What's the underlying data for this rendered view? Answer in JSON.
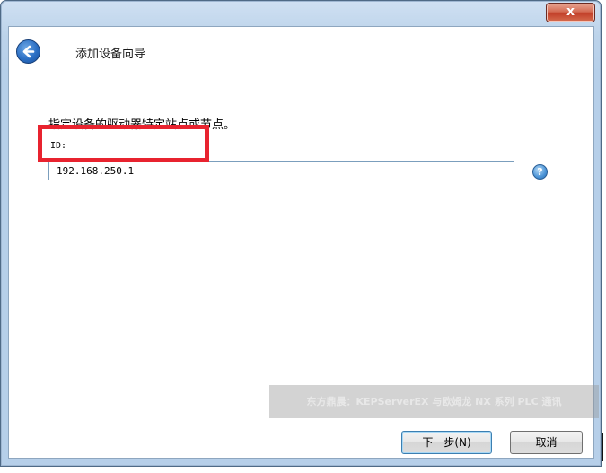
{
  "window": {
    "close_label": "x"
  },
  "header": {
    "title": "添加设备向导",
    "back_icon": "back-arrow-icon"
  },
  "form": {
    "instruction": "指定设备的驱动器特定站点或节点。",
    "id_label": "ID:",
    "id_value": "192.168.250.1",
    "help_label": "?"
  },
  "watermark": {
    "text": "东方鼎晨：KEPServerEX 与欧姆龙 NX 系列 PLC 通讯"
  },
  "footer": {
    "next_label": "下一步(N)",
    "cancel_label": "取消"
  },
  "colors": {
    "highlight": "#e8232f",
    "accent": "#2b6fc4"
  }
}
